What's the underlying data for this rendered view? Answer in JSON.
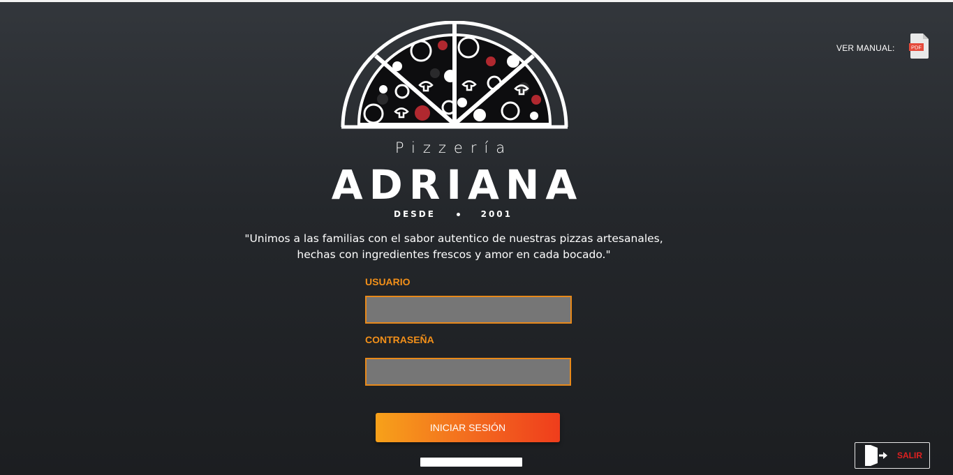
{
  "manual": {
    "label": "VER MANUAL:",
    "icon": "pdf-file-icon",
    "icon_text": "PDF"
  },
  "brand": {
    "subtitle": "Pizzería",
    "name": "ADRIANA",
    "since_word": "DESDE",
    "since_year": "2001",
    "logo_icon": "pizza-logo-icon"
  },
  "tagline": {
    "line1": "\"Unimos a las familias con el sabor autentico de nuestras pizzas artesanales,",
    "line2": "hechas con ingredientes frescos y amor en cada bocado.\""
  },
  "form": {
    "user_label": "USUARIO",
    "user_value": "",
    "password_label": "CONTRASEÑA",
    "password_value": "",
    "login_label": "INICIAR SESIÓN"
  },
  "exit": {
    "label": "SALIR",
    "icon": "exit-door-icon"
  },
  "colors": {
    "accent": "#f39019",
    "button_start": "#f7a11a",
    "button_end": "#ef3d1c",
    "exit_text": "#e02020",
    "input_bg": "#767676",
    "pepperoni": "#b0282f"
  }
}
